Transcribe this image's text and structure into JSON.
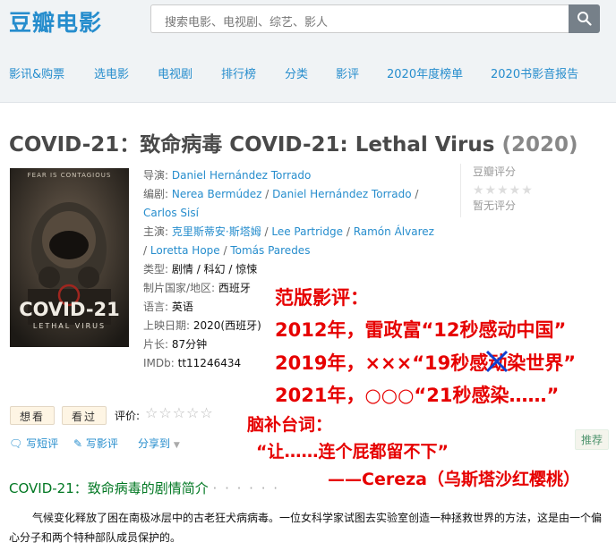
{
  "header": {
    "logo": "豆瓣电影",
    "search_placeholder": "搜索电影、电视剧、综艺、影人"
  },
  "nav": {
    "items": [
      "影讯&购票",
      "选电影",
      "电视剧",
      "排行榜",
      "分类",
      "影评",
      "2020年度榜单",
      "2020书影音报告"
    ]
  },
  "movie": {
    "title": "COVID-21：致命病毒 COVID-21: Lethal Virus",
    "year": "(2020)",
    "poster": {
      "tagline": "FEAR IS CONTAGIOUS",
      "title": "COVID-21",
      "subtitle": "LETHAL VIRUS"
    },
    "info": {
      "director_label": "导演:",
      "director": "Daniel Hernández Torrado",
      "writer_label": "编剧:",
      "writer_1": "Nerea Bermúdez",
      "writer_2": "Daniel Hernández Torrado",
      "writer_3": "Carlos Sisí",
      "cast_label": "主演:",
      "cast_1": "克里斯蒂安·斯塔姆",
      "cast_2": "Lee Partridge",
      "cast_3": "Ramón Álvarez",
      "cast_4": "Loretta Hope",
      "cast_5": "Tomás Paredes",
      "genre_label": "类型:",
      "genre": "剧情 / 科幻 / 惊悚",
      "country_label": "制片国家/地区:",
      "country": "西班牙",
      "language_label": "语言:",
      "language": "英语",
      "release_label": "上映日期:",
      "release": "2020(西班牙)",
      "runtime_label": "片长:",
      "runtime": "87分钟",
      "imdb_label": "IMDb:",
      "imdb": "tt11246434"
    }
  },
  "rating": {
    "label": "豆瓣评分",
    "empty_stars": "★★★★★",
    "no_rating": "暂无评分"
  },
  "user_actions": {
    "want_label": "想看",
    "seen_label": "看过",
    "rate_label": "评价:",
    "rate_stars": "☆☆☆☆☆",
    "short_review": "写短评",
    "review": "写影评",
    "share": "分享到",
    "recommend": "推荐"
  },
  "synopsis": {
    "title": "COVID-21：致命病毒的剧情简介",
    "dots": "· · · · · ·",
    "text": "气候变化释放了困在南极冰层中的古老狂犬病病毒。一位女科学家试图去实验室创造一种拯救世界的方法，这是由一个偏心分子和两个特种部队成员保护的。"
  },
  "overlay": {
    "line1": "范版影评：",
    "line2": "2012年，雷政富“12秒感动中国”",
    "line3_pre": "2019年，×××“19秒感",
    "line3_strike": "动",
    "line3_post": "染世界”",
    "line4": "2021年，○○○“21秒感染……”",
    "line5": "脑补台词：",
    "line6": "“让……连个屁都留不下”",
    "line7": "——Cereza（乌斯塔沙红樱桃）"
  }
}
